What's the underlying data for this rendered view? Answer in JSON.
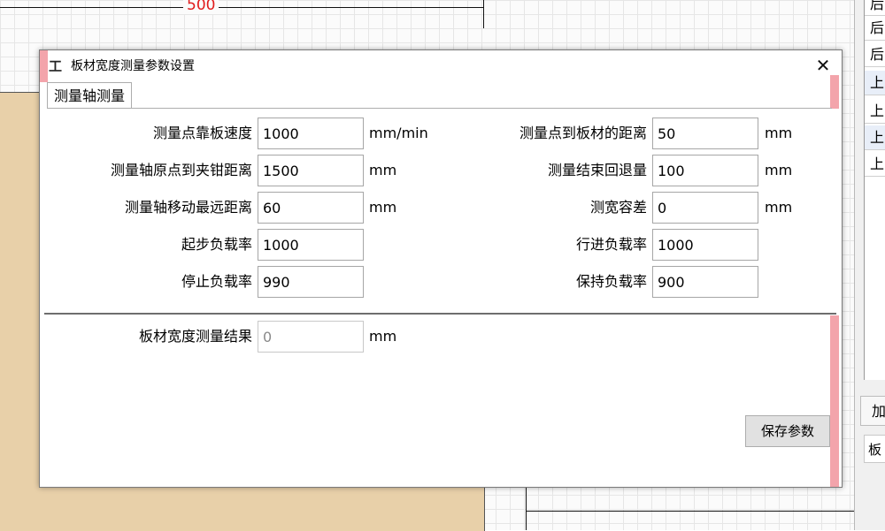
{
  "canvas": {
    "ruler_label": "500"
  },
  "right_panel": {
    "rows": [
      "后",
      "后",
      "上",
      "上",
      "上",
      "上"
    ],
    "tab_label": "加",
    "item_label": "板"
  },
  "dialog": {
    "title": "板材宽度测量参数设置",
    "icon_glyph": "工",
    "close_glyph": "✕",
    "tab_label": "测量轴测量",
    "left_params": [
      {
        "label": "测量点靠板速度",
        "value": "1000",
        "unit": "mm/min"
      },
      {
        "label": "测量轴原点到夹钳距离",
        "value": "1500",
        "unit": "mm"
      },
      {
        "label": "测量轴移动最远距离",
        "value": "60",
        "unit": "mm"
      },
      {
        "label": "起步负载率",
        "value": "1000",
        "unit": ""
      },
      {
        "label": "停止负载率",
        "value": "990",
        "unit": ""
      }
    ],
    "right_params": [
      {
        "label": "测量点到板材的距离",
        "value": "50",
        "unit": "mm"
      },
      {
        "label": "测量结束回退量",
        "value": "100",
        "unit": "mm"
      },
      {
        "label": "测宽容差",
        "value": "0",
        "unit": "mm"
      },
      {
        "label": "行进负载率",
        "value": "1000",
        "unit": ""
      },
      {
        "label": "保持负载率",
        "value": "900",
        "unit": ""
      }
    ],
    "result": {
      "label": "板材宽度测量结果",
      "value": "0",
      "unit": "mm"
    },
    "save_label": "保存参数"
  }
}
